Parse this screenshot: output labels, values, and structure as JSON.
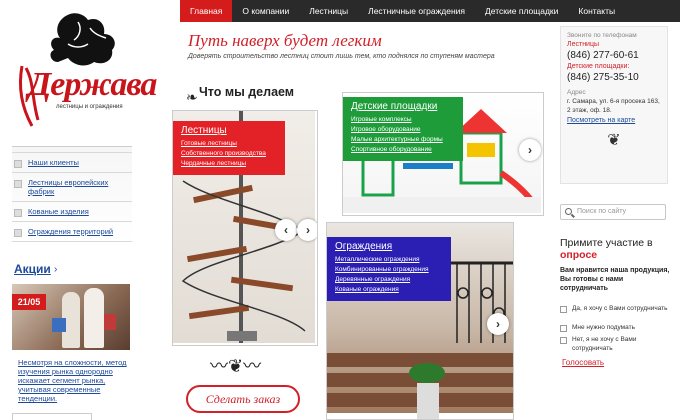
{
  "nav": {
    "items": [
      {
        "label": "Главная",
        "active": true
      },
      {
        "label": "О компании",
        "active": false
      },
      {
        "label": "Лестницы",
        "active": false
      },
      {
        "label": "Лестничные ограждения",
        "active": false
      },
      {
        "label": "Детские площадки",
        "active": false
      },
      {
        "label": "Контакты",
        "active": false
      }
    ]
  },
  "logo": {
    "name": "Держава",
    "subtitle": "лестницы и ограждения"
  },
  "slogan": {
    "title": "Путь наверх будет легким",
    "subtitle": "Доверять строительство лестниц стоит лишь тем, кто поднялся по ступеням мастера"
  },
  "sidebar": {
    "items": [
      {
        "label": "Наши клиенты"
      },
      {
        "label": "Лестницы европейских фабрик"
      },
      {
        "label": "Кованые изделия"
      },
      {
        "label": "Ограждения территорий"
      }
    ]
  },
  "promo": {
    "title": "Акции",
    "badge": "21/05",
    "text": "Несмотря на сложности, метод изучения рынка однородно искажает сегмент рынка, учитывая современные тенденции."
  },
  "what_we_do": {
    "title": "Что мы делаем"
  },
  "cards": {
    "stairs": {
      "title": "Лестницы",
      "links": [
        "Готовые лестницы",
        "Собственного производства",
        "Чердачные лестницы"
      ]
    },
    "playgrounds": {
      "title": "Детские площадки",
      "links": [
        "Игровые комплексы",
        "Игровое оборудование",
        "Малые архитектурные формы",
        "Спортивное оборудование"
      ]
    },
    "railings": {
      "title": "Ограждения",
      "links": [
        "Металлические ограждения",
        "Комбинированные ограждения",
        "Деревянные ограждения",
        "Кованые ограждения"
      ]
    }
  },
  "order_button": "Сделать заказ",
  "contact": {
    "call_label": "Звоните по телефонам",
    "stairs_label": "Лестницы",
    "stairs_phone": "(846) 277-60-61",
    "play_label": "Детские площадки:",
    "play_phone": "(846) 275-35-10",
    "address_label": "Адрес",
    "address": "г. Самара, ул. 6-я просека 163, 2 этаж, оф. 18.",
    "map_link": "Посмотреть на карте"
  },
  "search": {
    "placeholder": "Поиск по сайту"
  },
  "poll": {
    "title_1": "Примите участие в",
    "title_2": "опросе",
    "question": "Вам нравится наша продукция, Вы готовы с нами сотрудничать",
    "options": [
      "Да, я хочу с Вами сотрудничать",
      "Мне нужно подумать",
      "Нет, я не хочу с Вами сотрудничать"
    ],
    "vote": "Голосовать"
  },
  "colors": {
    "accent": "#d41c1c",
    "nav_bg": "#2a2a2a",
    "stairs_label": "#e32228",
    "play_label": "#1f9c3a",
    "rail_label": "#2a1fb2",
    "link": "#1d4a9a"
  },
  "icons": [
    "griffin-logo-icon",
    "search-icon",
    "chevron-right-icon",
    "chevron-left-icon",
    "ornament-icon"
  ]
}
